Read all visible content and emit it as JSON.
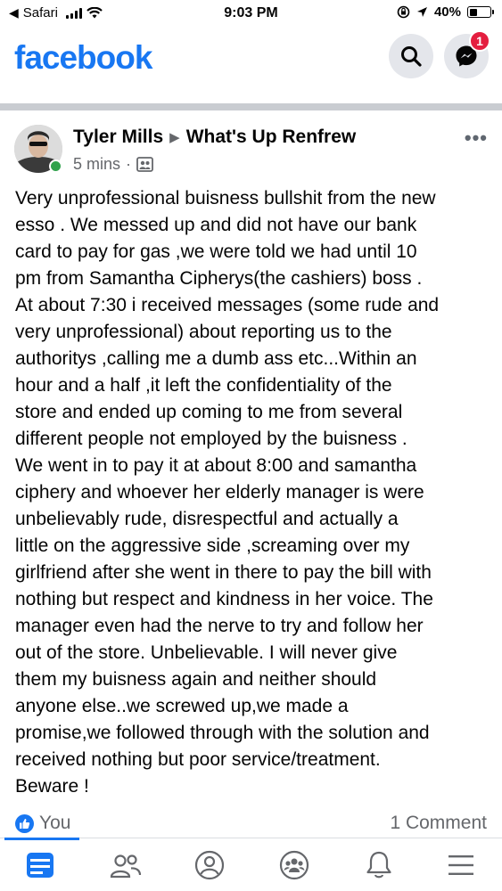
{
  "status_bar": {
    "back_label": "Safari",
    "time": "9:03 PM",
    "battery": "40%",
    "battery_level": 0.4
  },
  "header": {
    "logo": "facebook",
    "messenger_badge": "1"
  },
  "post": {
    "author": "Tyler Mills",
    "group": "What's Up Renfrew",
    "time": "5 mins",
    "separator": "·",
    "body_lines": [
      "Very unprofessional buisness bullshit from the new",
      "esso . We messed up and did not have our bank",
      "card to pay for gas ,we were told we had until 10",
      "pm from Samantha Cipherys(the cashiers) boss .",
      "At about 7:30 i received messages (some rude and",
      "very unprofessional) about reporting us to the",
      "authoritys ,calling me a dumb ass etc...Within an",
      "hour and a half ,it left the confidentiality of the",
      "store and ended up coming to me from several",
      "different people not employed by the buisness .",
      "We went in to pay it at about 8:00 and samantha",
      "ciphery and whoever her elderly manager is were",
      "unbelievably rude, disrespectful and actually a",
      "little on the aggressive side ,screaming over my",
      "girlfriend after she went in there to pay the bill with",
      "nothing but respect and kindness in her voice. The",
      "manager even had the nerve to try and follow her",
      "out of the store. Unbelievable.  I will never give",
      "them my buisness again and neither should",
      "anyone else..we screwed up,we made a",
      "promise,we followed through with the solution and",
      "received nothing but poor service/treatment.",
      "Beware !"
    ],
    "reactor": "You",
    "comment_count": "1 Comment"
  },
  "icons": {
    "search": "search-icon",
    "messenger": "messenger-icon",
    "more": "more-options-icon",
    "audience": "group-members-icon",
    "like": "like-icon"
  },
  "colors": {
    "brand": "#1877f2",
    "badge": "#e41e3f",
    "online": "#31a24c"
  }
}
